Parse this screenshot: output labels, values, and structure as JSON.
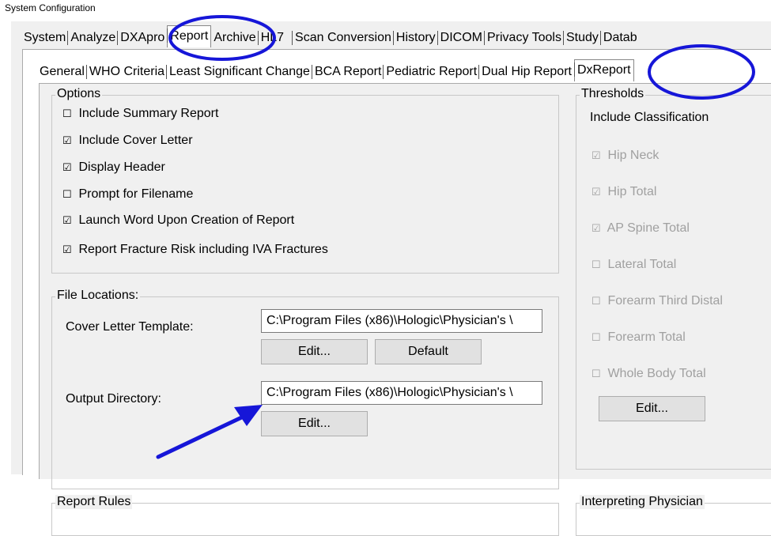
{
  "window": {
    "title": "System Configuration"
  },
  "main_tabs": [
    "System",
    "Analyze",
    "DXApro",
    "Report",
    "Archive",
    "HL7",
    "Scan Conversion",
    "History",
    "DICOM",
    "Privacy Tools",
    "Study",
    "Datab"
  ],
  "report_tabs": [
    "General",
    "WHO Criteria",
    "Least Significant Change",
    "BCA Report",
    "Pediatric Report",
    "Dual Hip Report",
    "DxReport"
  ],
  "options": {
    "title": "Options",
    "items": [
      {
        "label": "Include Summary Report",
        "mark": "☐"
      },
      {
        "label": "Include Cover Letter",
        "mark": "☑"
      },
      {
        "label": "Display Header",
        "mark": "☑"
      },
      {
        "label": "Prompt for Filename",
        "mark": "☐"
      },
      {
        "label": "Launch Word Upon Creation of Report",
        "mark": "☑"
      },
      {
        "label": "Report Fracture Risk including IVA Fractures",
        "mark": "☑"
      }
    ]
  },
  "file_locations": {
    "title": "File Locations:",
    "cover_label": "Cover Letter Template:",
    "cover_value": "C:\\Program Files (x86)\\Hologic\\Physician's \\",
    "edit_label": "Edit...",
    "default_label": "Default",
    "output_label": "Output Directory:",
    "output_value": "C:\\Program Files (x86)\\Hologic\\Physician's \\",
    "edit2_label": "Edit..."
  },
  "report_rules": {
    "title": "Report Rules"
  },
  "thresholds": {
    "title": "Thresholds",
    "include_classification": "Include Classification",
    "items": [
      {
        "label": "Hip Neck",
        "mark": "☑"
      },
      {
        "label": "Hip Total",
        "mark": "☑"
      },
      {
        "label": "AP Spine Total",
        "mark": "☑"
      },
      {
        "label": "Lateral Total",
        "mark": "☐"
      },
      {
        "label": "Forearm Third Distal",
        "mark": "☐"
      },
      {
        "label": "Forearm Total",
        "mark": "☐"
      },
      {
        "label": "Whole Body Total",
        "mark": "☐"
      }
    ],
    "edit_label": "Edit..."
  },
  "interpreting_physician": {
    "title": "Interpreting Physician"
  },
  "annotation_color": "#1616d8"
}
